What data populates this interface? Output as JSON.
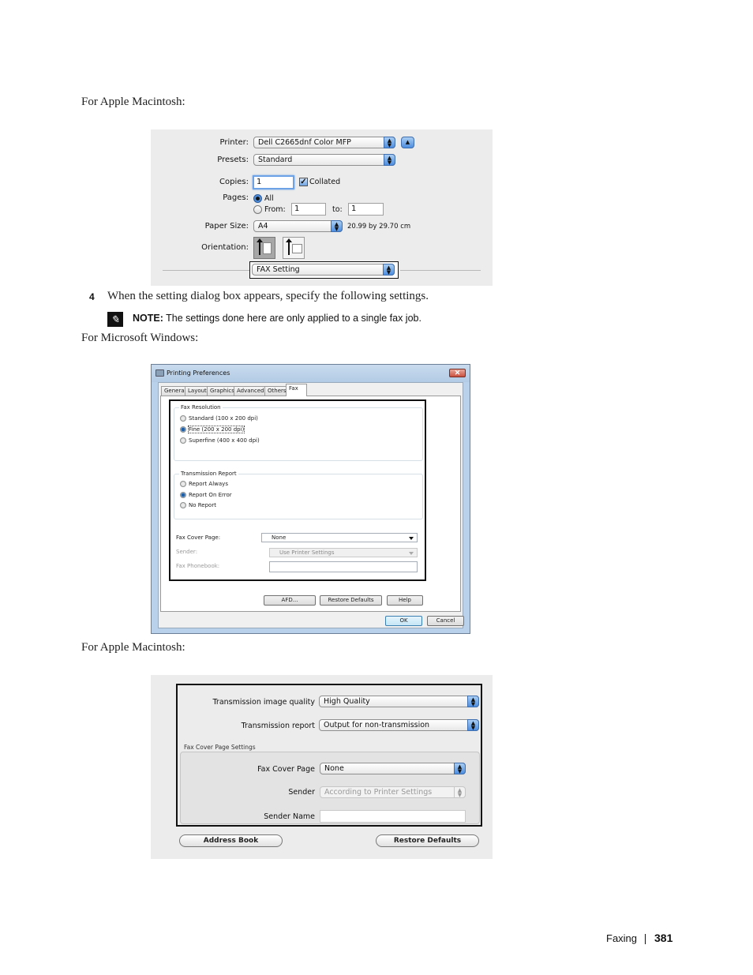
{
  "captions": {
    "mac_first": "For Apple Macintosh:",
    "windows": "For Microsoft Windows:",
    "mac_second": "For Apple Macintosh:"
  },
  "mac_print_dialog": {
    "printer_label": "Printer:",
    "printer_value": "Dell C2665dnf Color MFP",
    "presets_label": "Presets:",
    "presets_value": "Standard",
    "copies_label": "Copies:",
    "copies_value": "1",
    "collated_label": "Collated",
    "collated_checked": true,
    "pages_label": "Pages:",
    "pages_all_label": "All",
    "pages_from_label": "From:",
    "pages_from_value": "1",
    "pages_to_label": "to:",
    "pages_to_value": "1",
    "pages_selected": "All",
    "paper_size_label": "Paper Size:",
    "paper_size_value": "A4",
    "paper_dimensions": "20.99 by 29.70 cm",
    "orientation_label": "Orientation:",
    "orientation_selected": "portrait",
    "panel_value": "FAX Setting"
  },
  "step": {
    "number": "4",
    "text": "When the setting dialog box appears, specify the following settings.",
    "note_label": "NOTE:",
    "note_text": " The settings done here are only applied to a single fax job."
  },
  "windows_dialog": {
    "title": "Printing Preferences",
    "close_symbol": "✕",
    "tabs": [
      {
        "label": "General",
        "active": false
      },
      {
        "label": "Layout",
        "active": false
      },
      {
        "label": "Graphics",
        "active": false
      },
      {
        "label": "Advanced",
        "active": false
      },
      {
        "label": "Others",
        "active": false
      },
      {
        "label": "Fax",
        "active": true
      }
    ],
    "fax_resolution": {
      "title": "Fax Resolution",
      "options": [
        {
          "label": "Standard (100 x 200 dpi)",
          "selected": false
        },
        {
          "label": "Fine (200 x 200 dpi)",
          "selected": true
        },
        {
          "label": "Superfine (400 x 400 dpi)",
          "selected": false
        }
      ]
    },
    "transmission_report": {
      "title": "Transmission Report",
      "options": [
        {
          "label": "Report Always",
          "selected": false
        },
        {
          "label": "Report On Error",
          "selected": true
        },
        {
          "label": "No Report",
          "selected": false
        }
      ]
    },
    "fax_cover_page_label": "Fax Cover Page:",
    "fax_cover_page_value": "None",
    "sender_label": "Sender:",
    "sender_value": "Use Printer Settings",
    "fax_phonebook_label": "Fax Phonebook:",
    "fax_phonebook_value": "",
    "buttons": {
      "afd": "AFD...",
      "restore_defaults": "Restore Defaults",
      "help": "Help",
      "ok": "OK",
      "cancel": "Cancel"
    }
  },
  "mac_fax_dialog": {
    "image_quality_label": "Transmission image quality",
    "image_quality_value": "High Quality",
    "report_label": "Transmission report",
    "report_value": "Output for non-transmission",
    "group_title": "Fax Cover Page Settings",
    "cover_page_label": "Fax Cover Page",
    "cover_page_value": "None",
    "sender_label": "Sender",
    "sender_value": "According to Printer Settings",
    "sender_name_label": "Sender Name",
    "sender_name_value": "",
    "address_book_button": "Address Book",
    "restore_defaults_button": "Restore Defaults"
  },
  "footer": {
    "section": "Faxing",
    "page_number": "381"
  }
}
